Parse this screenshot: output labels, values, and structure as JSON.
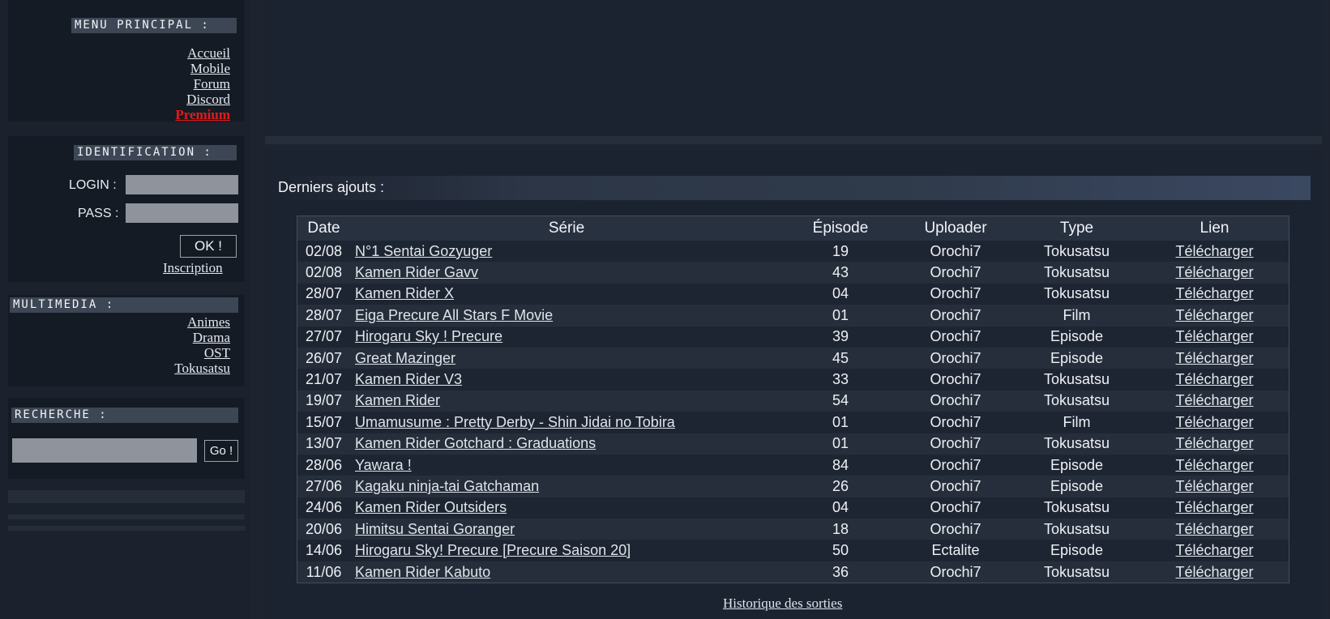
{
  "sidebar": {
    "menu_title": "Menu principal :",
    "menu_links": [
      "Accueil",
      "Mobile",
      "Forum",
      "Discord",
      "Premium"
    ],
    "ident_title": "Identification :",
    "login_label": "LOGIN :",
    "pass_label": "PASS :",
    "ok_label": "OK !",
    "register_label": "Inscription",
    "multimedia_title": "Multimedia :",
    "multimedia_links": [
      "Animes",
      "Drama",
      "OST",
      "Tokusatsu"
    ],
    "search_title": "Recherche :",
    "go_label": "Go !"
  },
  "main": {
    "section_title": "Derniers ajouts :",
    "columns": [
      "Date",
      "Série",
      "Épisode",
      "Uploader",
      "Type",
      "Lien"
    ],
    "rows": [
      [
        "02/08",
        "N°1 Sentai Gozyuger",
        "19",
        "Orochi7",
        "Tokusatsu",
        "Télécharger"
      ],
      [
        "02/08",
        "Kamen Rider Gavv",
        "43",
        "Orochi7",
        "Tokusatsu",
        "Télécharger"
      ],
      [
        "28/07",
        "Kamen Rider X",
        "04",
        "Orochi7",
        "Tokusatsu",
        "Télécharger"
      ],
      [
        "28/07",
        "Eiga Precure All Stars F Movie",
        "01",
        "Orochi7",
        "Film",
        "Télécharger"
      ],
      [
        "27/07",
        "Hirogaru Sky ! Precure",
        "39",
        "Orochi7",
        "Episode",
        "Télécharger"
      ],
      [
        "26/07",
        "Great Mazinger",
        "45",
        "Orochi7",
        "Episode",
        "Télécharger"
      ],
      [
        "21/07",
        "Kamen Rider V3",
        "33",
        "Orochi7",
        "Tokusatsu",
        "Télécharger"
      ],
      [
        "19/07",
        "Kamen Rider",
        "54",
        "Orochi7",
        "Tokusatsu",
        "Télécharger"
      ],
      [
        "15/07",
        "Umamusume : Pretty Derby - Shin Jidai no Tobira",
        "01",
        "Orochi7",
        "Film",
        "Télécharger"
      ],
      [
        "13/07",
        "Kamen Rider Gotchard : Graduations",
        "01",
        "Orochi7",
        "Tokusatsu",
        "Télécharger"
      ],
      [
        "28/06",
        "Yawara !",
        "84",
        "Orochi7",
        "Episode",
        "Télécharger"
      ],
      [
        "27/06",
        "Kagaku ninja-tai Gatchaman",
        "26",
        "Orochi7",
        "Episode",
        "Télécharger"
      ],
      [
        "24/06",
        "Kamen Rider Outsiders",
        "04",
        "Orochi7",
        "Tokusatsu",
        "Télécharger"
      ],
      [
        "20/06",
        "Himitsu Sentai Goranger",
        "18",
        "Orochi7",
        "Tokusatsu",
        "Télécharger"
      ],
      [
        "14/06",
        "Hirogaru Sky! Precure [Precure Saison 20]",
        "50",
        "Ectalite",
        "Episode",
        "Télécharger"
      ],
      [
        "11/06",
        "Kamen Rider Kabuto",
        "36",
        "Orochi7",
        "Tokusatsu",
        "Télécharger"
      ]
    ],
    "history_link": "Historique des sorties"
  }
}
